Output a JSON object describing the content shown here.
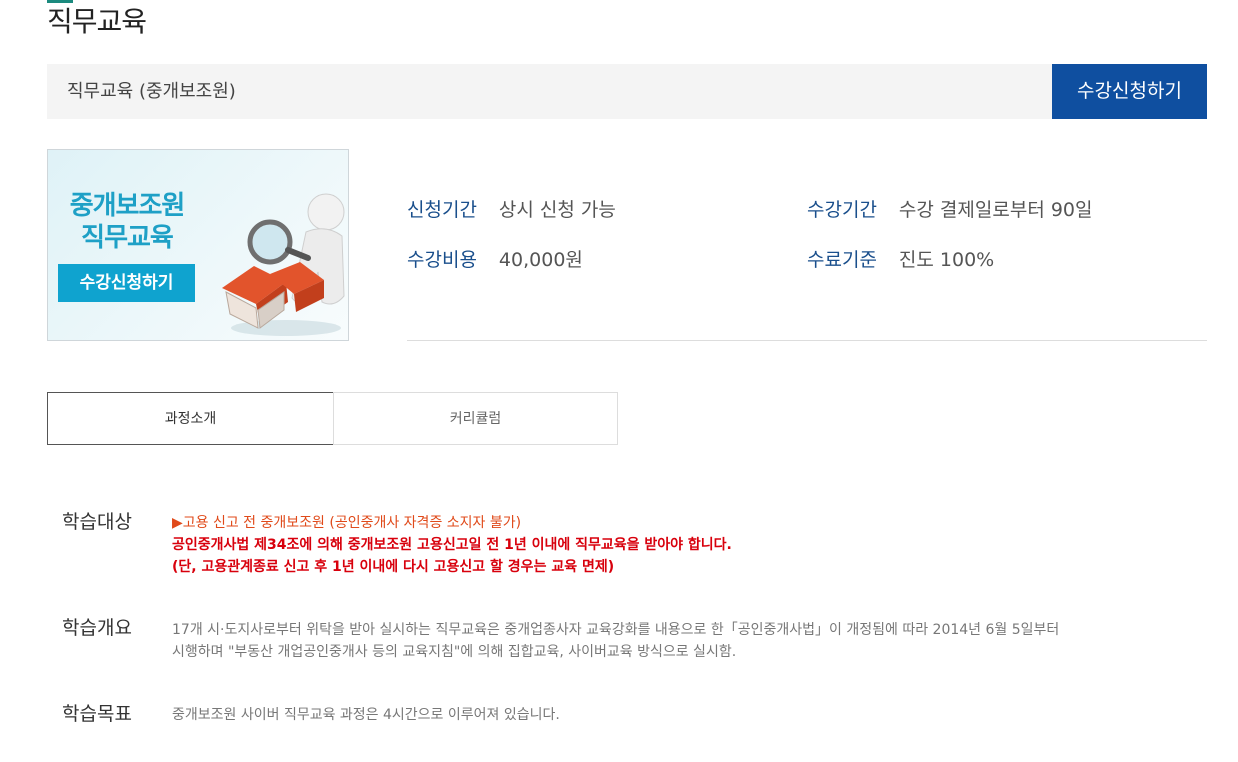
{
  "page": {
    "title": "직무교육"
  },
  "course_bar": {
    "name": "직무교육 (중개보조원)",
    "apply_label": "수강신청하기"
  },
  "thumbnail": {
    "title_line1": "중개보조원",
    "title_line2": "직무교육",
    "button_label": "수강신청하기"
  },
  "info": {
    "apply_period": {
      "label": "신청기간",
      "value": "상시 신청 가능"
    },
    "study_period": {
      "label": "수강기간",
      "value": "수강 결제일로부터 90일"
    },
    "fee": {
      "label": "수강비용",
      "value": "40,000원"
    },
    "completion": {
      "label": "수료기준",
      "value": "진도 100%"
    }
  },
  "tabs": [
    {
      "label": "과정소개",
      "active": true
    },
    {
      "label": "커리큘럼",
      "active": false
    }
  ],
  "sections": {
    "target": {
      "label": "학습대상",
      "line1": "▶고용 신고 전 중개보조원 (공인중개사 자격증 소지자 불가)",
      "line2": "공인중개사법 제34조에 의해 중개보조원 고용신고일 전 1년 이내에 직무교육을 받아야 합니다.",
      "line3": "(단, 고용관계종료 신고 후 1년 이내에 다시 고용신고 할 경우는 교육 면제)"
    },
    "overview": {
      "label": "학습개요",
      "line1": "17개 시·도지사로부터 위탁을 받아 실시하는 직무교육은 중개업종사자 교육강화를 내용으로 한「공인중개사법」이 개정됨에 따라 2014년 6월 5일부터",
      "line2": "시행하며 \"부동산 개업공인중개사 등의 교육지침\"에 의해 집합교육, 사이버교육 방식으로 실시함."
    },
    "goal": {
      "label": "학습목표",
      "text": "중개보조원 사이버 직무교육 과정은 4시간으로 이루어져 있습니다."
    }
  },
  "colors": {
    "accent": "#0f4fa0",
    "label_blue": "#1a4f8c",
    "warning_red": "#d8000c",
    "thumb_cyan": "#0fa3cf"
  }
}
